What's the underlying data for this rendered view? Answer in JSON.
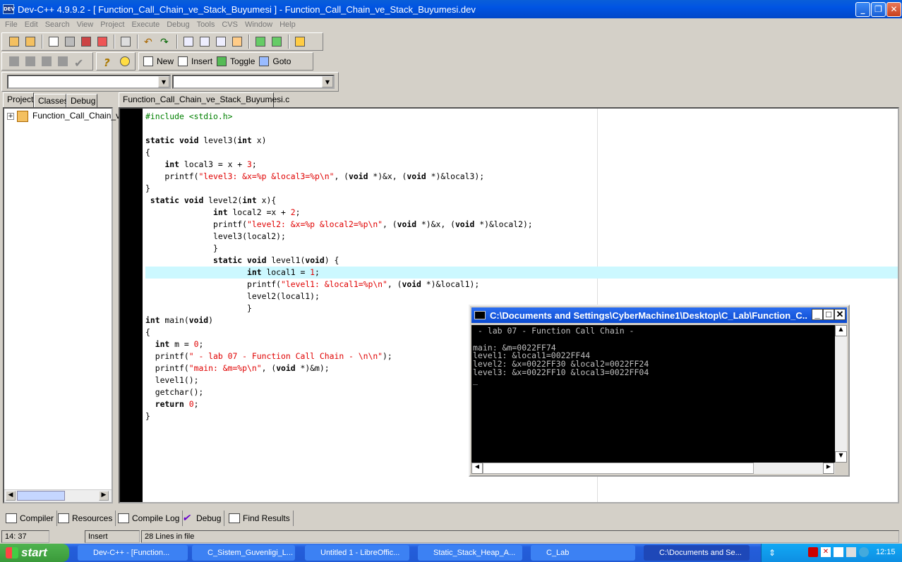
{
  "window": {
    "app_icon_text": "DEV",
    "title": "Dev-C++ 4.9.9.2  -  [ Function_Call_Chain_ve_Stack_Buyumesi ] - Function_Call_Chain_ve_Stack_Buyumesi.dev",
    "min_icon": "minimize-icon",
    "max_icon": "restore-icon",
    "close_icon": "close-icon"
  },
  "menu": [
    "File",
    "Edit",
    "Search",
    "View",
    "Project",
    "Execute",
    "Debug",
    "Tools",
    "CVS",
    "Window",
    "Help"
  ],
  "toolbar2": {
    "new_label": "New",
    "insert_label": "Insert",
    "toggle_label": "Toggle",
    "goto_label": "Goto"
  },
  "left_tabs": [
    "Project",
    "Classes",
    "Debug"
  ],
  "project_tree": {
    "item": "Function_Call_Chain_v",
    "expand": "+"
  },
  "editor": {
    "tab": "Function_Call_Chain_ve_Stack_Buyumesi.c",
    "lines": [
      "#include <stdio.h>",
      "",
      "static void level3(int x)",
      "{",
      "    int local3 = x + 3;",
      "    printf(\"level3: &x=%p &local3=%p\\n\", (void *)&x, (void *)&local3);",
      "}",
      " static void level2(int x){",
      "              int local2 =x + 2;",
      "              printf(\"level2: &x=%p &local2=%p\\n\", (void *)&x, (void *)&local2);",
      "              level3(local2);",
      "              }",
      "              static void level1(void) {",
      "                     int local1 = 1;",
      "                     printf(\"level1: &local1=%p\\n\", (void *)&local1);",
      "                     level2(local1);",
      "                     }",
      "int main(void)",
      "{",
      "  int m = 0;",
      "  printf(\" - lab 07 - Function Call Chain - \\n\\n\");",
      "  printf(\"main: &m=%p\\n\", (void *)&m);",
      "  level1();",
      "  getchar();",
      "  return 0;",
      "}"
    ]
  },
  "console": {
    "title": "C:\\Documents and Settings\\CyberMachine1\\Desktop\\C_Lab\\Function_C...",
    "lines": [
      " - lab 07 - Function Call Chain -",
      "",
      "main: &m=0022FF74",
      "level1: &local1=0022FF44",
      "level2: &x=0022FF30 &local2=0022FF24",
      "level3: &x=0022FF10 &local3=0022FF04",
      "_"
    ]
  },
  "bottom_tabs": [
    {
      "label": "Compiler",
      "icon": "compiler-icon"
    },
    {
      "label": "Resources",
      "icon": "resources-icon"
    },
    {
      "label": "Compile Log",
      "icon": "compile-log-icon"
    },
    {
      "label": "Debug",
      "icon": "debug-check-icon"
    },
    {
      "label": "Find Results",
      "icon": "find-results-icon"
    }
  ],
  "status": {
    "position": "14: 37",
    "mode": "Insert",
    "lines": "28 Lines in file"
  },
  "taskbar": {
    "start": "start",
    "tasks": [
      "Dev-C++ - [Function...",
      "C_Sistem_Guvenligi_L...",
      "Untitled 1 - LibreOffic...",
      "Static_Stack_Heap_A...",
      "C_Lab",
      "C:\\Documents and Se..."
    ],
    "clock": "12:15"
  }
}
